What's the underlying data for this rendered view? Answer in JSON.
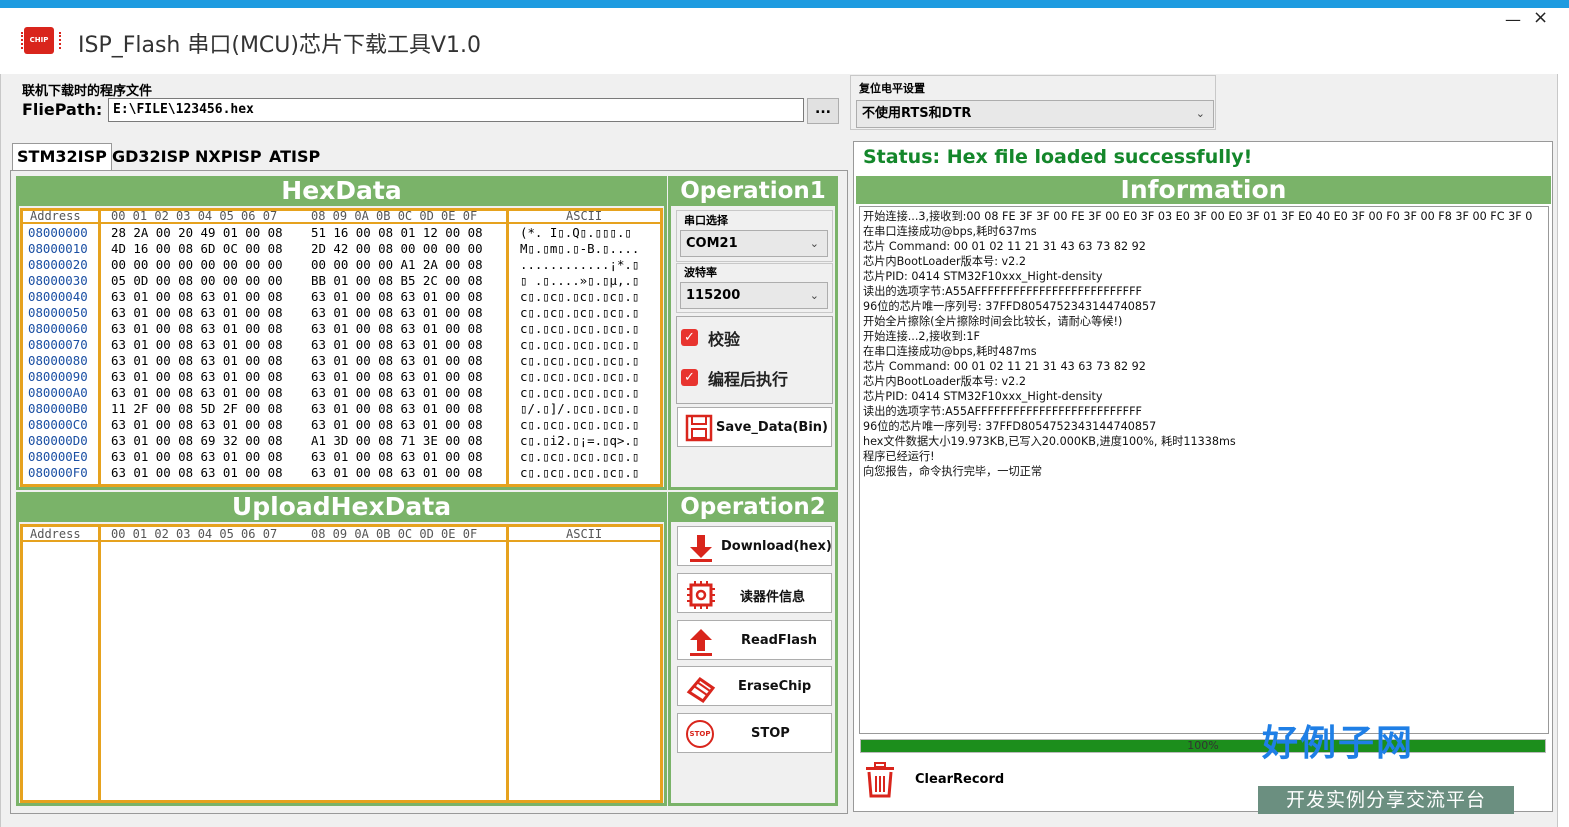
{
  "window": {
    "title": "ISP_Flash 串口(MCU)芯片下载工具V1.0",
    "icon_text": "CHIP",
    "minimize": "—",
    "close": "×"
  },
  "file": {
    "section_label": "联机下载时的程序文件",
    "path_label": "FliePath:",
    "path_value": "E:\\FILE\\123456.hex",
    "browse_label": "..."
  },
  "reset": {
    "label": "复位电平设置",
    "value": "不使用RTS和DTR"
  },
  "tabs": [
    {
      "label": "STM32ISP",
      "active": true
    },
    {
      "label": "GD32ISP",
      "active": false
    },
    {
      "label": "NXPISP",
      "active": false
    },
    {
      "label": "ATISP",
      "active": false
    }
  ],
  "hexdata": {
    "title": "HexData",
    "header_addr": "Address",
    "header_bytes_a": "00 01 02 03 04 05 06 07",
    "header_bytes_b": "08 09 0A 0B 0C 0D 0E 0F",
    "header_ascii": "ASCII",
    "rows": [
      {
        "addr": "08000000",
        "a": "28 2A 00 20 49 01 00 08",
        "b": "51 16 00 08 01 12 00 08",
        "ascii": "(*. I▯.Q▯.▯▯▯.▯"
      },
      {
        "addr": "08000010",
        "a": "4D 16 00 08 6D 0C 00 08",
        "b": "2D 42 00 08 00 00 00 00",
        "ascii": "M▯.▯m▯.▯-B.▯...."
      },
      {
        "addr": "08000020",
        "a": "00 00 00 00 00 00 00 00",
        "b": "00 00 00 00 A1 2A 00 08",
        "ascii": "............¡*.▯"
      },
      {
        "addr": "08000030",
        "a": "05 0D 00 08 00 00 00 00",
        "b": "BB 01 00 08 B5 2C 00 08",
        "ascii": "▯ .▯....»▯.▯µ,.▯"
      },
      {
        "addr": "08000040",
        "a": "63 01 00 08 63 01 00 08",
        "b": "63 01 00 08 63 01 00 08",
        "ascii": "c▯.▯c▯.▯c▯.▯c▯.▯"
      },
      {
        "addr": "08000050",
        "a": "63 01 00 08 63 01 00 08",
        "b": "63 01 00 08 63 01 00 08",
        "ascii": "c▯.▯c▯.▯c▯.▯c▯.▯"
      },
      {
        "addr": "08000060",
        "a": "63 01 00 08 63 01 00 08",
        "b": "63 01 00 08 63 01 00 08",
        "ascii": "c▯.▯c▯.▯c▯.▯c▯.▯"
      },
      {
        "addr": "08000070",
        "a": "63 01 00 08 63 01 00 08",
        "b": "63 01 00 08 63 01 00 08",
        "ascii": "c▯.▯c▯.▯c▯.▯c▯.▯"
      },
      {
        "addr": "08000080",
        "a": "63 01 00 08 63 01 00 08",
        "b": "63 01 00 08 63 01 00 08",
        "ascii": "c▯.▯c▯.▯c▯.▯c▯.▯"
      },
      {
        "addr": "08000090",
        "a": "63 01 00 08 63 01 00 08",
        "b": "63 01 00 08 63 01 00 08",
        "ascii": "c▯.▯c▯.▯c▯.▯c▯.▯"
      },
      {
        "addr": "080000A0",
        "a": "63 01 00 08 63 01 00 08",
        "b": "63 01 00 08 63 01 00 08",
        "ascii": "c▯.▯c▯.▯c▯.▯c▯.▯"
      },
      {
        "addr": "080000B0",
        "a": "11 2F 00 08 5D 2F 00 08",
        "b": "63 01 00 08 63 01 00 08",
        "ascii": "▯/.▯]/.▯c▯.▯c▯.▯"
      },
      {
        "addr": "080000C0",
        "a": "63 01 00 08 63 01 00 08",
        "b": "63 01 00 08 63 01 00 08",
        "ascii": "c▯.▯c▯.▯c▯.▯c▯.▯"
      },
      {
        "addr": "080000D0",
        "a": "63 01 00 08 69 32 00 08",
        "b": "A1 3D 00 08 71 3E 00 08",
        "ascii": "c▯.▯i2.▯¡=.▯q>.▯"
      },
      {
        "addr": "080000E0",
        "a": "63 01 00 08 63 01 00 08",
        "b": "63 01 00 08 63 01 00 08",
        "ascii": "c▯.▯c▯.▯c▯.▯c▯.▯"
      },
      {
        "addr": "080000F0",
        "a": "63 01 00 08 63 01 00 08",
        "b": "63 01 00 08 63 01 00 08",
        "ascii": "c▯.▯c▯.▯c▯.▯c▯.▯"
      }
    ]
  },
  "upload": {
    "title": "UploadHexData",
    "header_addr": "Address",
    "header_bytes_a": "00 01 02 03 04 05 06 07",
    "header_bytes_b": "08 09 0A 0B 0C 0D 0E 0F",
    "header_ascii": "ASCII"
  },
  "operation1": {
    "title": "Operation1",
    "port_label": "串口选择",
    "port_value": "COM21",
    "baud_label": "波特率",
    "baud_value": "115200",
    "verify_label": "校验",
    "run_label": "编程后执行",
    "save_label": "Save_Data(Bin)"
  },
  "operation2": {
    "title": "Operation2",
    "download_label": "Download(hex)",
    "chipinfo_label": "读器件信息",
    "readflash_label": "ReadFlash",
    "erase_label": "EraseChip",
    "stop_label": "STOP",
    "stop_icon_text": "STOP"
  },
  "status": {
    "text": "Status: Hex file loaded successfully!"
  },
  "information": {
    "title": "Information",
    "log": [
      "开始连接...3,接收到:00 08 FE 3F 3F 00 FE 3F 00 E0 3F 03 E0 3F 00 E0 3F 01 3F E0 40 E0 3F 00 F0 3F 00 F8 3F 00 FC 3F 0",
      "在串口连接成功@bps,耗时637ms",
      "芯片 Command: 00 01 02 11 21 31 43 63 73 82 92",
      "芯片内BootLoader版本号: v2.2",
      "芯片PID: 0414  STM32F10xxx_Hight-density",
      "读出的选项字节:A55AFFFFFFFFFFFFFFFFFFFFFFFFFF",
      "96位的芯片唯一序列号: 37FFD8054752343144740857",
      "开始全片擦除(全片擦除时间会比较长，请耐心等候!)",
      "开始连接...2,接收到:1F",
      "在串口连接成功@bps,耗时487ms",
      "芯片 Command: 00 01 02 11 21 31 43 63 73 82 92",
      "芯片内BootLoader版本号: v2.2",
      "芯片PID: 0414  STM32F10xxx_Hight-density",
      "读出的选项字节:A55AFFFFFFFFFFFFFFFFFFFFFFFFFF",
      "96位的芯片唯一序列号: 37FFD8054752343144740857",
      "hex文件数据大小19.973KB,已写入20.000KB,进度100%, 耗时11338ms",
      "程序已经运行!",
      "向您报告，命令执行完毕，一切正常"
    ],
    "progress_text": "100%",
    "progress_value": 100,
    "clear_label": "ClearRecord"
  },
  "watermark": {
    "main": "好例子网",
    "sub": "开发实例分享交流平台"
  },
  "colors": {
    "accent_green": "#7ab369",
    "grid_orange": "#e6a21e",
    "status_green": "#14872b",
    "progress_green": "#1c8e1c"
  }
}
